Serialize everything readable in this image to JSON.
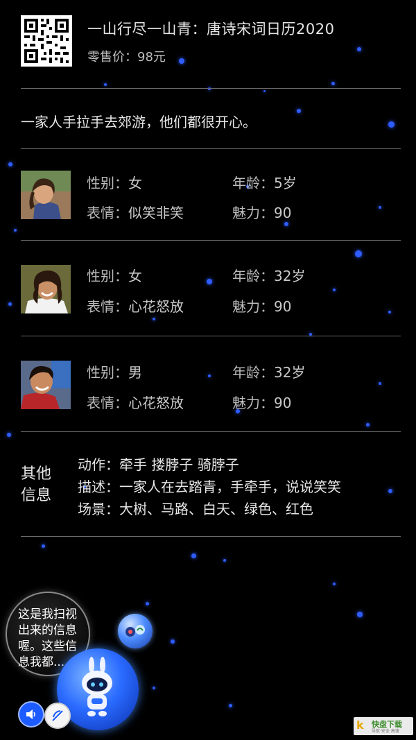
{
  "product": {
    "title": "一山行尽一山青：唐诗宋词日历2020",
    "price_label": "零售价：",
    "price_value": "98元"
  },
  "description": "一家人手拉手去郊游，他们都很开心。",
  "labels": {
    "gender": "性别：",
    "age": "年龄：",
    "expression": "表情：",
    "charm": "魅力："
  },
  "people": [
    {
      "gender": "女",
      "age": "5岁",
      "expression": "似笑非笑",
      "charm": "90"
    },
    {
      "gender": "女",
      "age": "32岁",
      "expression": "心花怒放",
      "charm": "90"
    },
    {
      "gender": "男",
      "age": "32岁",
      "expression": "心花怒放",
      "charm": "90"
    }
  ],
  "other": {
    "title_line1": "其他",
    "title_line2": "信息",
    "action": "动作：牵手 搂脖子 骑脖子",
    "describe": "描述：一家人在去踏青，手牵手，说说笑笑",
    "scene": "场景：大树、马路、白天、绿色、红色"
  },
  "assistant": {
    "bubble_text": "这是我扫视出来的信息喔。这些信息我都..."
  },
  "watermark": {
    "logo": "k",
    "brand": "快盘下载",
    "sub": "导航·安全·高速"
  },
  "colors": {
    "background": "#000000",
    "star": "#2f5cff",
    "divider": "#6a6a6a",
    "orb": "#2a6bff"
  },
  "icons": [
    "qr-code-icon",
    "speaker-icon",
    "mute-icon",
    "robot-icon"
  ]
}
